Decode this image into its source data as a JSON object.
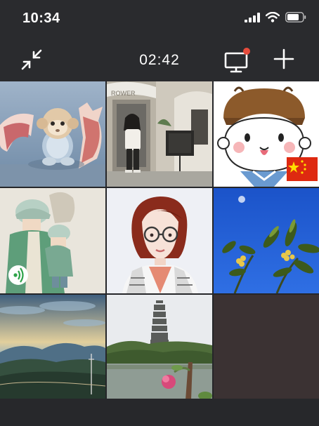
{
  "status": {
    "time": "10:34",
    "icons": [
      "signal-icon",
      "wifi-icon",
      "battery-icon"
    ]
  },
  "toolbar": {
    "timer": "02:42",
    "collapse_icon": "collapse-arrows-icon",
    "screen_icon": "screen-share-icon",
    "add_icon": "plus-icon",
    "notification_dot_color": "#e74c3c"
  },
  "tiles": [
    {
      "name": "monkey-in-eggshell"
    },
    {
      "name": "woman-at-cafe",
      "sign_text": "ROWER"
    },
    {
      "name": "cartoon-boy-with-flag"
    },
    {
      "name": "parent-and-child-illustration",
      "badge_icon": "sound-wave-icon"
    },
    {
      "name": "cartoon-woman-with-glasses"
    },
    {
      "name": "yellow-flowers-blue-sky"
    },
    {
      "name": "mountain-sunset-landscape"
    },
    {
      "name": "pagoda-and-lake"
    }
  ],
  "colors": {
    "background": "#252629",
    "toolbar": "#2a2b2e",
    "accent_dot": "#e74c3c"
  }
}
